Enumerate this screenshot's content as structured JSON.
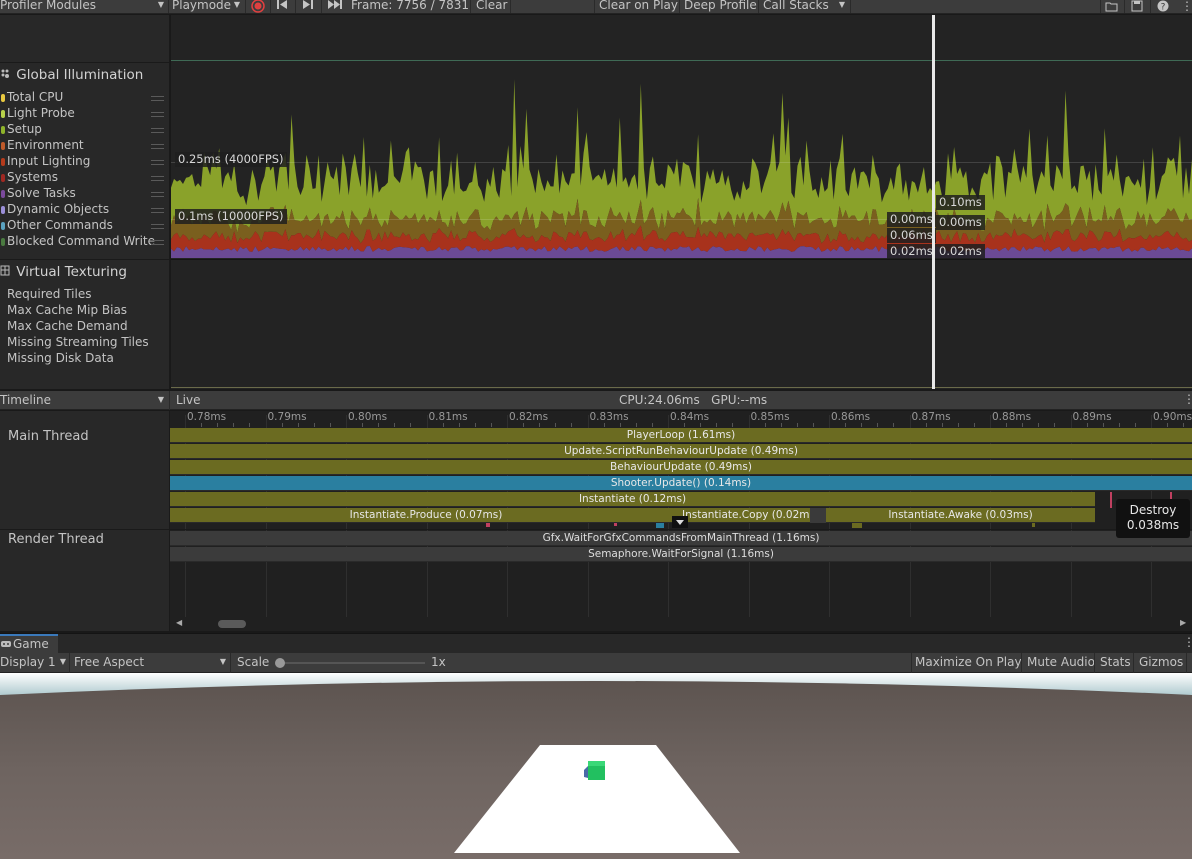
{
  "toolbar": {
    "profiler_modules": "Profiler Modules",
    "playmode": "Playmode",
    "frame": "Frame: 7756 / 7831",
    "clear": "Clear",
    "clear_on_play": "Clear on Play",
    "deep_profile": "Deep Profile",
    "call_stacks": "Call Stacks"
  },
  "modules": {
    "global_illumination": {
      "title": "Global Illumination",
      "items": [
        "Total CPU",
        "Light Probe",
        "Setup",
        "Environment",
        "Input Lighting",
        "Systems",
        "Solve Tasks",
        "Dynamic Objects",
        "Other Commands",
        "Blocked Command Write"
      ],
      "colors": [
        "#e8c840",
        "#b8d14a",
        "#8fb32b",
        "#c05a2a",
        "#b53b1c",
        "#a02822",
        "#7b4a9c",
        "#9b8fd8",
        "#5aa2c0",
        "#4a7a40"
      ]
    },
    "virtual_texturing": {
      "title": "Virtual Texturing",
      "items": [
        "Required Tiles",
        "Max Cache Mip Bias",
        "Max Cache Demand",
        "Missing Streaming Tiles",
        "Missing Disk Data"
      ]
    }
  },
  "chart": {
    "label_025": "0.25ms (4000FPS)",
    "label_01": "0.1ms (10000FPS)",
    "sel_values_left": [
      "0.00ms",
      "0.06ms",
      "0.02ms"
    ],
    "sel_values_right": [
      "0.10ms",
      "0.00ms",
      "0.02ms"
    ]
  },
  "timeline": {
    "mode": "Timeline",
    "live": "Live",
    "cpu_gpu": "CPU:24.06ms   GPU:--ms",
    "ticks": [
      "0.78ms",
      "0.79ms",
      "0.80ms",
      "0.81ms",
      "0.82ms",
      "0.83ms",
      "0.84ms",
      "0.85ms",
      "0.86ms",
      "0.87ms",
      "0.88ms",
      "0.89ms",
      "0.90ms"
    ],
    "main_thread": "Main Thread",
    "render_thread": "Render Thread",
    "samples": {
      "player_loop": "PlayerLoop (1.61ms)",
      "update_script": "Update.ScriptRunBehaviourUpdate (0.49ms)",
      "behaviour_update": "BehaviourUpdate (0.49ms)",
      "shooter_update": "Shooter.Update() (0.14ms)",
      "instantiate": "Instantiate (0.12ms)",
      "instantiate_produce": "Instantiate.Produce (0.07ms)",
      "instantiate_copy": "Instantiate.Copy (0.02ms)",
      "instantiate_awake": "Instantiate.Awake (0.03ms)",
      "gfx_wait": "Gfx.WaitForGfxCommandsFromMainThread (1.16ms)",
      "semaphore": "Semaphore.WaitForSignal (1.16ms)"
    },
    "tooltip": {
      "name": "Destroy",
      "time": "0.038ms"
    }
  },
  "game": {
    "tab": "Game",
    "display": "Display 1",
    "aspect": "Free Aspect",
    "scale_label": "Scale",
    "scale_value": "1x",
    "maximize": "Maximize On Play",
    "mute": "Mute Audio",
    "stats": "Stats",
    "gizmos": "Gizmos"
  }
}
